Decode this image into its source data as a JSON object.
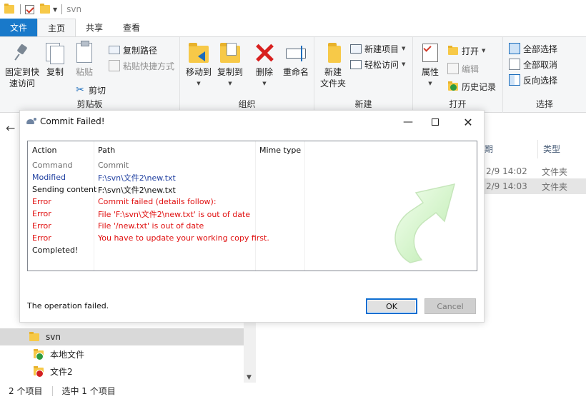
{
  "window": {
    "title": "svn"
  },
  "tabs": {
    "file": "文件",
    "home": "主页",
    "share": "共享",
    "view": "查看"
  },
  "ribbon": {
    "clipboard": {
      "label": "剪贴板",
      "pin": "固定到快速访问",
      "pin_line1": "固定到快",
      "pin_line2": "速访问",
      "copy": "复制",
      "paste": "粘贴",
      "copy_path": "复制路径",
      "paste_shortcut": "粘贴快捷方式",
      "cut": "剪切"
    },
    "organize": {
      "label": "组织",
      "move_to": "移动到",
      "copy_to": "复制到",
      "delete": "删除",
      "rename": "重命名"
    },
    "new": {
      "label": "新建",
      "new_folder_line1": "新建",
      "new_folder_line2": "文件夹",
      "new_item": "新建项目",
      "easy_access": "轻松访问"
    },
    "open": {
      "label": "打开",
      "properties": "属性",
      "open": "打开",
      "edit": "编辑",
      "history": "历史记录"
    },
    "select": {
      "label": "选择",
      "select_all": "全部选择",
      "select_none": "全部取消",
      "invert": "反向选择"
    }
  },
  "file_list": {
    "col_date": "期",
    "col_type": "类型",
    "rows": [
      {
        "date": "2/9 14:02",
        "type": "文件夹"
      },
      {
        "date": "2/9 14:03",
        "type": "文件夹"
      }
    ]
  },
  "dialog": {
    "title": "Commit Failed!",
    "columns": {
      "action": "Action",
      "path": "Path",
      "mime": "Mime type"
    },
    "log": [
      {
        "action": "Command",
        "path": "Commit",
        "kind": "cmd"
      },
      {
        "action": "Modified",
        "path": "F:\\svn\\文件2\\new.txt",
        "kind": "mod"
      },
      {
        "action": "Sending content",
        "path": "F:\\svn\\文件2\\new.txt",
        "kind": "norm"
      },
      {
        "action": "Error",
        "path": "Commit failed (details follow):",
        "kind": "err"
      },
      {
        "action": "Error",
        "path": "File 'F:\\svn\\文件2\\new.txt' is out of date",
        "kind": "err"
      },
      {
        "action": "Error",
        "path": "File '/new.txt' is out of date",
        "kind": "err"
      },
      {
        "action": "Error",
        "path": "You have to update your working copy first.",
        "kind": "err"
      },
      {
        "action": "Completed!",
        "path": "",
        "kind": "norm"
      }
    ],
    "message": "The operation failed.",
    "ok": "OK",
    "cancel": "Cancel"
  },
  "nav_pane": {
    "items": [
      {
        "label": "svn"
      },
      {
        "label": "本地文件"
      },
      {
        "label": "文件2"
      }
    ]
  },
  "status": {
    "count": "2 个项目",
    "selected": "选中 1 个项目"
  }
}
